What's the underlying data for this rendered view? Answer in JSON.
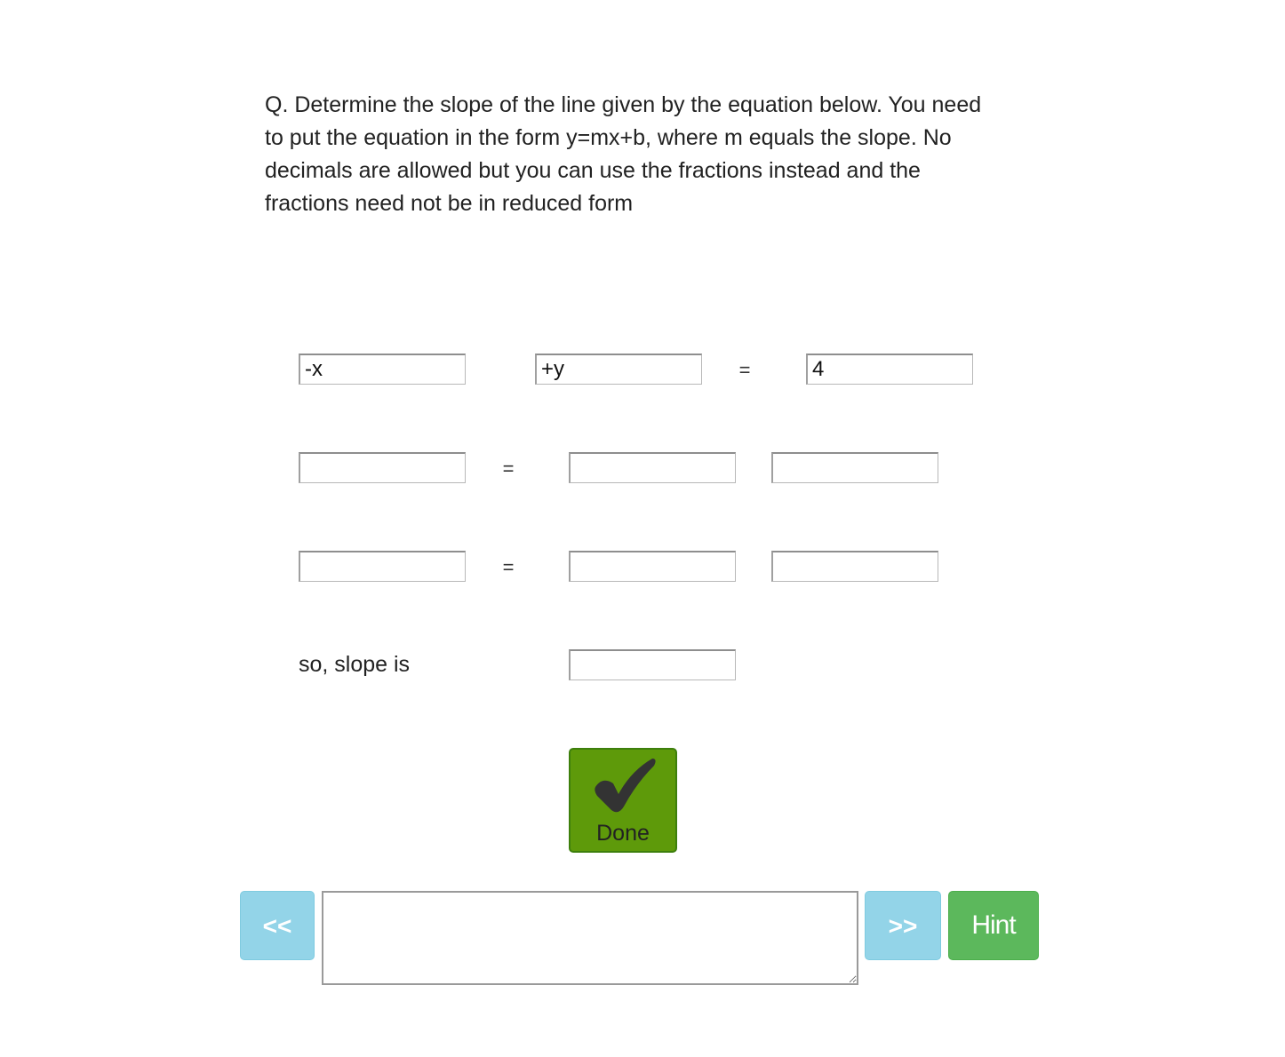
{
  "question": {
    "text": "Q. Determine the slope of the line given by the equation below. You need to put the equation in the form y=mx+b, where m equals the slope. No decimals are allowed but you can use the fractions instead and the fractions need not be in reduced form"
  },
  "equation": {
    "row1": {
      "term1": "-x",
      "term2": "+y",
      "equals": "=",
      "rhs": "4"
    },
    "row2": {
      "lhs": "",
      "equals": "=",
      "rhs1": "",
      "rhs2": ""
    },
    "row3": {
      "lhs": "",
      "equals": "=",
      "rhs1": "",
      "rhs2": ""
    }
  },
  "slope": {
    "label": "so, slope is",
    "value": ""
  },
  "done_button": {
    "label": "Done",
    "icon": "checkmark-icon",
    "color": "#5e9a0a"
  },
  "nav": {
    "prev_label": "<<",
    "next_label": ">>",
    "hint_label": "Hint",
    "nav_color": "#93d4e8",
    "hint_color": "#5cb85c"
  },
  "feedback": {
    "value": ""
  }
}
